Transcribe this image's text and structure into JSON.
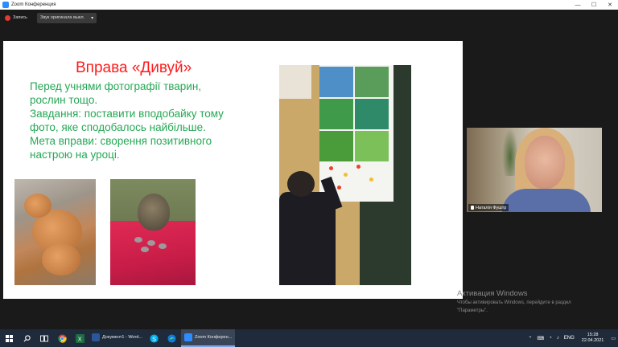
{
  "window": {
    "title": "Zoom Конференция",
    "buttons": [
      "—",
      "☐",
      "✕"
    ]
  },
  "toolbar": {
    "record_label": "Запись",
    "sound_label": "Звук оригинала выкл.",
    "sound_caret": "▾"
  },
  "slide": {
    "title": "Вправа «Дивуй»",
    "lines": [
      "Перед учнями фотографії тварин,",
      "рослин тощо.",
      "Завдання: поставити вподобайку тому",
      "фото, яке сподобалось найбільше.",
      "Мета вправи: сворення позитивного",
      "настрою на уроці."
    ]
  },
  "participant": {
    "name": "Наталія Фуштр"
  },
  "activation": {
    "title": "Активация Windows",
    "line1": "Чтобы активировать Windows, перейдите в раздел",
    "line2": "\"Параметры\"."
  },
  "taskbar": {
    "apps": [
      {
        "label": "Документ1 - Word..."
      },
      {
        "label": "Zoom Конферен..."
      }
    ],
    "tray": {
      "language": "ENG",
      "time": "15:28",
      "date": "22.04.2021"
    }
  },
  "colors": {
    "slide_title": "#ff1a1a",
    "slide_text": "#25a855",
    "taskbar": "#1f2a3a",
    "zoom_blue": "#2d8cff"
  }
}
